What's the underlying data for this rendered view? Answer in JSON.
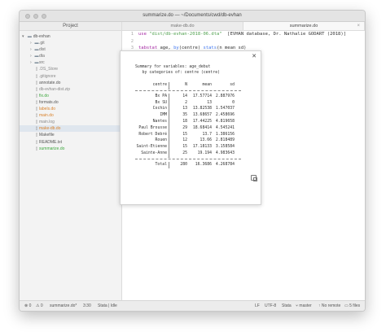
{
  "window": {
    "title": "summarize.do — ~/Documents/cwd/db-evhan"
  },
  "sidebar": {
    "header": "Project",
    "root": "db-evhan",
    "items": [
      {
        "label": ".git",
        "type": "folder",
        "color": "#6f6f6f"
      },
      {
        "label": "dist",
        "type": "folder",
        "color": "#6f6f6f"
      },
      {
        "label": "dta",
        "type": "folder",
        "color": "#6f6f6f"
      },
      {
        "label": "src",
        "type": "folder",
        "color": "#6f6f6f"
      },
      {
        "label": ".DS_Store",
        "type": "file",
        "color": "#8a8a8a"
      },
      {
        "label": ".gitignore",
        "type": "file",
        "color": "#8a8a8a"
      },
      {
        "label": "annotate.do",
        "type": "file",
        "color": "#555555"
      },
      {
        "label": "db-evhan-dist.zip",
        "type": "file",
        "color": "#8a8a8a"
      },
      {
        "label": "fix.do",
        "type": "file",
        "color": "#3fa83f"
      },
      {
        "label": "formats.do",
        "type": "file",
        "color": "#555555"
      },
      {
        "label": "labels.do",
        "type": "file",
        "color": "#d9822b"
      },
      {
        "label": "main.do",
        "type": "file",
        "color": "#d9822b"
      },
      {
        "label": "main.log",
        "type": "file",
        "color": "#8a8a8a"
      },
      {
        "label": "make-db.do",
        "type": "file",
        "color": "#d9822b",
        "selected": true
      },
      {
        "label": "Makefile",
        "type": "file",
        "color": "#555555"
      },
      {
        "label": "README.txt",
        "type": "file",
        "color": "#555555"
      },
      {
        "label": "summarize.do",
        "type": "file",
        "color": "#3fa83f"
      }
    ]
  },
  "tabs": [
    {
      "label": "make-db.do",
      "active": false
    },
    {
      "label": "summarize.do",
      "active": true
    }
  ],
  "editor": {
    "lines": [
      "1",
      "2",
      "3"
    ],
    "line1": {
      "kw": "use",
      "str": "\"dist/db-evhan-2018-06.dta\"",
      "rest": "  [EVHAN database, Dr. Nathalie GODART (2018)]"
    },
    "line3": {
      "kw1": "tabstat",
      "a": " age, ",
      "kw2": "by",
      "b": "(centre) ",
      "kw3": "stats",
      "c": "(n mean sd)"
    }
  },
  "output": {
    "line1": "Summary for variables: age_debut",
    "line2": "   by categories of: centre (centre)",
    "header": [
      "centre",
      "N",
      "mean",
      "sd"
    ],
    "rows": [
      [
        "Bx PA",
        "14",
        "17.57714",
        "2.887976"
      ],
      [
        "Bx SU",
        "2",
        "13",
        "0"
      ],
      [
        "Cochin",
        "13",
        "13.82538",
        "1.547037"
      ],
      [
        "IMM",
        "35",
        "13.68657",
        "2.458696"
      ],
      [
        "Nantes",
        "18",
        "17.44225",
        "4.819658"
      ],
      [
        "Paul Brousse",
        "29",
        "18.68414",
        "4.545241"
      ],
      [
        "Robert Debré",
        "15",
        "13.7",
        "1.386156"
      ],
      [
        "Rouen",
        "12",
        "13.66",
        "2.818489"
      ],
      [
        "Saint-Etienne",
        "15",
        "17.18133",
        "3.158584"
      ],
      [
        "Sainte-Anne",
        "25",
        "19.194",
        "4.983643"
      ]
    ],
    "total": [
      "Total",
      "280",
      "16.3686",
      "4.268784"
    ]
  },
  "status": {
    "errors": "0",
    "warnings": "0",
    "file": "summarize.do*",
    "cursor": "3:30",
    "stata": "Stata | Idle",
    "line_ending": "LF",
    "encoding": "UTF-8",
    "grammar": "Stata",
    "branch": "master",
    "remote": "No remote",
    "files": "5 files"
  }
}
